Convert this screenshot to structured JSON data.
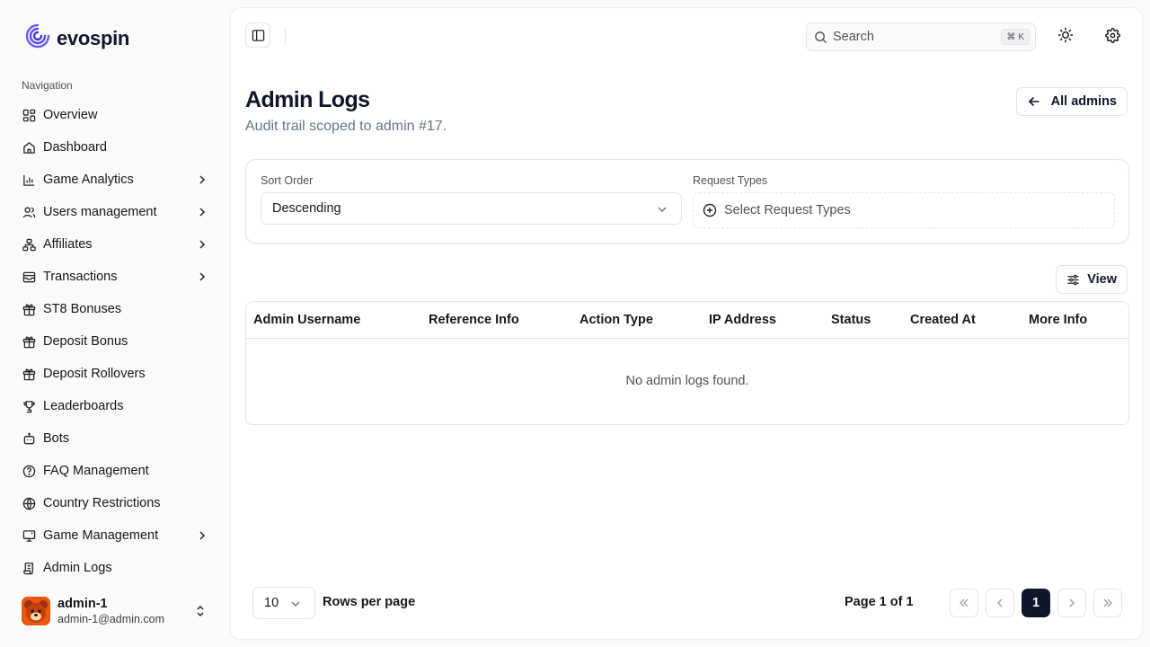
{
  "brand": {
    "name": "evospin",
    "logo": "swirl-logo"
  },
  "sidebar": {
    "heading": "Navigation",
    "items": [
      {
        "label": "Overview",
        "icon": "grid-icon",
        "expandable": false
      },
      {
        "label": "Dashboard",
        "icon": "home-icon",
        "expandable": false
      },
      {
        "label": "Game Analytics",
        "icon": "bar-chart-icon",
        "expandable": true
      },
      {
        "label": "Users management",
        "icon": "users-icon",
        "expandable": true
      },
      {
        "label": "Affiliates",
        "icon": "network-icon",
        "expandable": true
      },
      {
        "label": "Transactions",
        "icon": "wallet-icon",
        "expandable": true
      },
      {
        "label": "ST8 Bonuses",
        "icon": "gift-icon",
        "expandable": false
      },
      {
        "label": "Deposit Bonus",
        "icon": "gift-icon",
        "expandable": false
      },
      {
        "label": "Deposit Rollovers",
        "icon": "gift-icon",
        "expandable": false
      },
      {
        "label": "Leaderboards",
        "icon": "trophy-icon",
        "expandable": false
      },
      {
        "label": "Bots",
        "icon": "bot-icon",
        "expandable": false
      },
      {
        "label": "FAQ Management",
        "icon": "help-circle-icon",
        "expandable": false
      },
      {
        "label": "Country Restrictions",
        "icon": "globe-icon",
        "expandable": false
      },
      {
        "label": "Game Management",
        "icon": "monitor-icon",
        "expandable": true
      },
      {
        "label": "Admin Logs",
        "icon": "scroll-icon",
        "expandable": false
      }
    ]
  },
  "user": {
    "name": "admin-1",
    "email": "admin-1@admin.com"
  },
  "header": {
    "search_placeholder": "Search",
    "shortcut_symbol": "⌘",
    "shortcut_key": "K"
  },
  "page": {
    "title": "Admin Logs",
    "subtitle": "Audit trail scoped to admin #17.",
    "back_button": "All admins"
  },
  "filters": {
    "sort_label": "Sort Order",
    "sort_value": "Descending",
    "request_label": "Request Types",
    "request_placeholder": "Select Request Types"
  },
  "table": {
    "view_button": "View",
    "columns": [
      "Admin Username",
      "Reference Info",
      "Action Type",
      "IP Address",
      "Status",
      "Created At",
      "More Info"
    ],
    "empty_message": "No admin logs found."
  },
  "pagination": {
    "rows_per_page_value": "10",
    "rows_per_page_label": "Rows per page",
    "page_info": "Page 1 of 1",
    "current_page": "1"
  },
  "colors": {
    "accent": "#0f172a",
    "brand_purple": "#5b4ee8",
    "muted": "#64748b"
  }
}
